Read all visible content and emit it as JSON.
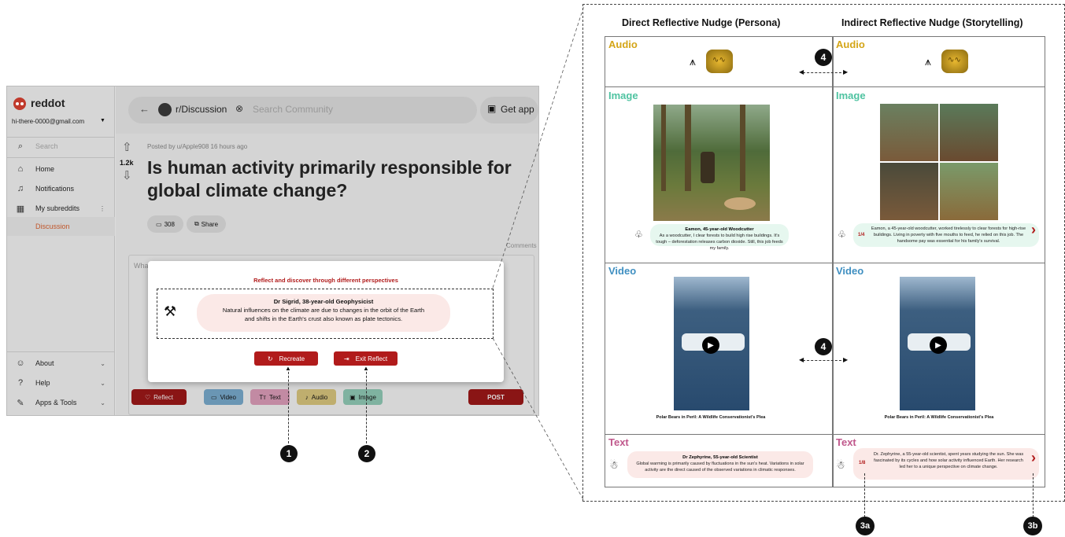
{
  "app": {
    "logo_text": "reddot",
    "account": "hi-there-0000@gmail.com",
    "search_placeholder": "Search",
    "sidebar_items": [
      "Home",
      "Notifications",
      "My subreddits",
      "Discussion"
    ],
    "sidebar_bottom": [
      "About",
      "Help",
      "Apps & Tools"
    ],
    "community": "r/Discussion",
    "community_search": "Search Community",
    "get_app": "Get app",
    "posted_by": "Posted by u/Apple908  16 hours ago",
    "votes": "1.2k",
    "post_title": "Is human activity primarily responsible for global climate change?",
    "comments_count": "308",
    "share": "Share",
    "comments_label": "Comments",
    "comment_placeholder": "Wha",
    "toolbar": {
      "reflect": "Reflect",
      "video": "Video",
      "text": "Text",
      "audio": "Audio",
      "image": "Image",
      "post": "POST"
    }
  },
  "modal": {
    "heading": "Reflect and discover through different perspectives",
    "persona_name": "Dr Sigrid, 38-year-old Geophysicist",
    "persona_text": "Natural influences on the climate are due to changes in the orbit of the Earth and shifts in the Earth's crust also known as plate tectonics.",
    "recreate": "Recreate",
    "exit": "Exit Reflect"
  },
  "markers": {
    "m1": "1",
    "m2": "2",
    "m3a": "3a",
    "m3b": "3b",
    "m4": "4"
  },
  "panel": {
    "left_heading": "Direct Reflective Nudge (Persona)",
    "right_heading": "Indirect Reflective Nudge (Storytelling)",
    "sections": {
      "audio": "Audio",
      "image": "Image",
      "video": "Video",
      "text": "Text"
    },
    "colors": {
      "audio": "#d4a517",
      "image": "#4fc3a1",
      "video": "#3f8fc1",
      "text": "#c0588c"
    },
    "image_left_title": "Eamon, 45-year-old Woodcutter",
    "image_left_text": "As a woodcutter, I clear forests to build high rise buildings. It's tough – deforestation releases carbon dioxide. Still, this job feeds my family.",
    "image_right_counter": "1/4",
    "image_right_text": "Eamon, a 45-year-old woodcutter, worked tirelessly to clear forests for high-rise buildings. Living in poverty with five mouths to feed, he relied on this job. The handsome pay was essential for his family's survival.",
    "video_caption": "Polar Bears in Peril: A Wildlife Conservationist's Plea",
    "text_left_title": "Dr Zephyrine, 55-year-old Scientist",
    "text_left_text": "Global warming is primarily caused by fluctuations in the sun's heat. Variations in solar activity are the direct caused of the observed variations in climatic responses.",
    "text_right_counter": "1/8",
    "text_right_text": "Dr. Zephyrine, a 55-year-old scientist, spent years studying the sun. She was fascinated by its cycles and how solar activity influenced Earth. Her research led her to a unique perspective on climate change."
  }
}
